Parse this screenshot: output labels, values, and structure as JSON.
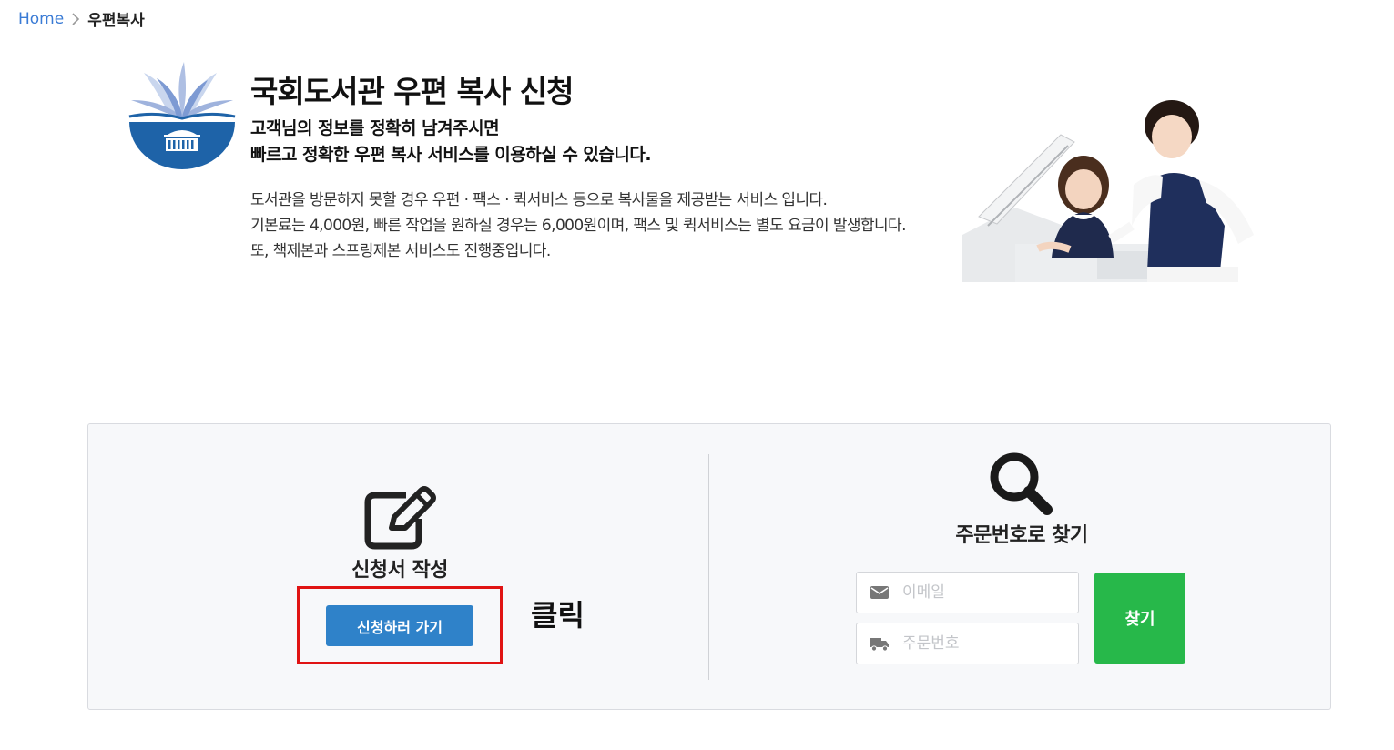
{
  "breadcrumb": {
    "home": "Home",
    "current": "우편복사"
  },
  "hero": {
    "title": "국회도서관 우편 복사 신청",
    "subtitle_lines": [
      "고객님의 정보를 정확히 남겨주시면",
      "빠르고 정확한 우편 복사 서비스를 이용하실 수 있습니다."
    ],
    "description_lines": [
      "도서관을 방문하지 못할 경우 우편 · 팩스 · 퀵서비스 등으로 복사물을 제공받는 서비스 입니다.",
      "기본료는 4,000원, 빠른 작업을 원하실 경우는 6,000원이며, 팩스 및 퀵서비스는 별도 요금이 발생합니다.",
      "또, 책제본과 스프링제본 서비스도 진행중입니다."
    ]
  },
  "apply": {
    "icon": "edit-icon",
    "title": "신청서 작성",
    "button_label": "신청하러 가기",
    "annotation": "클릭"
  },
  "lookup": {
    "icon": "search-icon",
    "title": "주문번호로 찾기",
    "email_placeholder": "이메일",
    "email_value": "",
    "email_icon": "envelope-icon",
    "order_placeholder": "주문번호",
    "order_value": "",
    "order_icon": "truck-icon",
    "button_label": "찾기"
  },
  "colors": {
    "link": "#3a7bd5",
    "primary_button": "#2f82c9",
    "find_button": "#27b84a",
    "annotation_border": "#e01313",
    "logo_blue": "#1e63a8"
  }
}
